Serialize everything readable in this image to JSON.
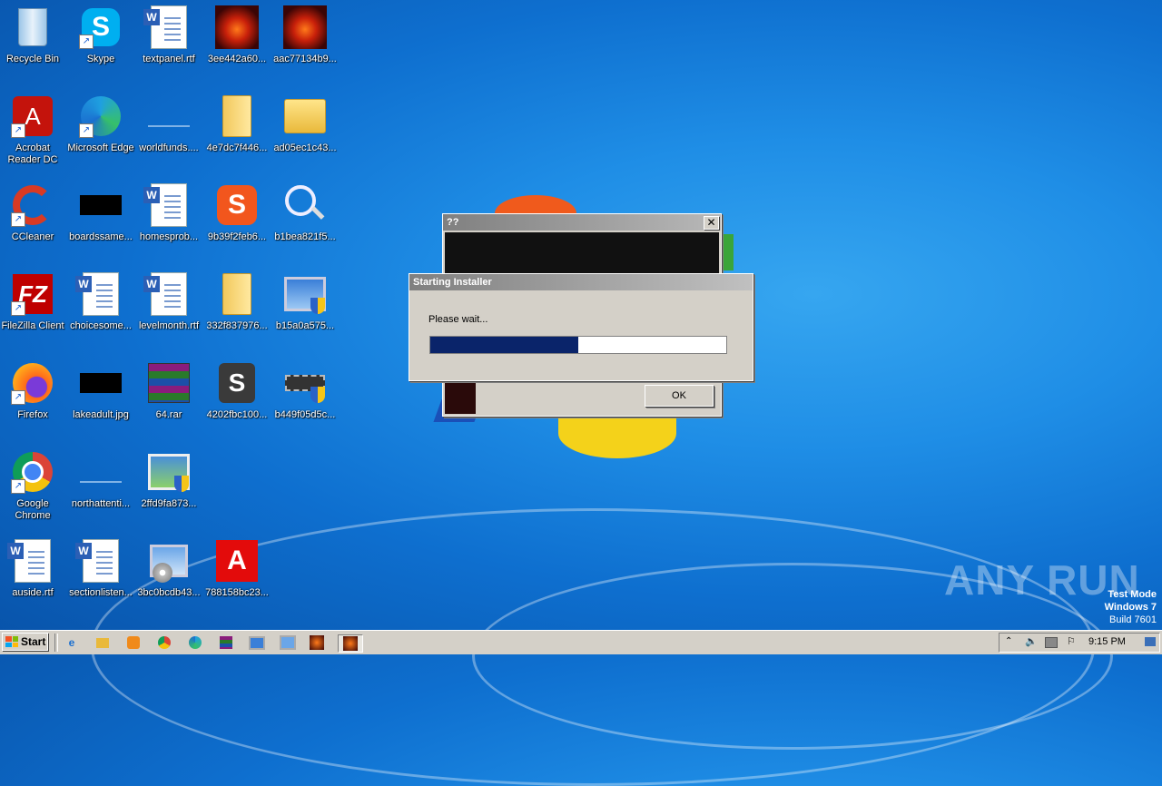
{
  "desktop_icons": [
    {
      "label": "Recycle Bin",
      "icon": "recycle-bin-icon"
    },
    {
      "label": "Skype",
      "icon": "skype-icon"
    },
    {
      "label": "textpanel.rtf",
      "icon": "word-document-icon"
    },
    {
      "label": "3ee442a60...",
      "icon": "fire-horse-icon"
    },
    {
      "label": "aac77134b9...",
      "icon": "fire-horse-icon"
    },
    {
      "label": "Acrobat Reader DC",
      "icon": "acrobat-icon"
    },
    {
      "label": "Microsoft Edge",
      "icon": "edge-icon"
    },
    {
      "label": "worldfunds....",
      "icon": "blank-file-icon"
    },
    {
      "label": "4e7dc7f446...",
      "icon": "folder-icon"
    },
    {
      "label": "ad05ec1c43...",
      "icon": "folder-icon"
    },
    {
      "label": "CCleaner",
      "icon": "ccleaner-icon"
    },
    {
      "label": "boardssame...",
      "icon": "black-image-icon"
    },
    {
      "label": "homesprob...",
      "icon": "word-document-icon"
    },
    {
      "label": "9b39f2feb6...",
      "icon": "sogou-icon"
    },
    {
      "label": "b1bea821f5...",
      "icon": "magnifier-icon"
    },
    {
      "label": "FileZilla Client",
      "icon": "filezilla-icon"
    },
    {
      "label": "choicesome...",
      "icon": "word-document-icon"
    },
    {
      "label": "levelmonth.rtf",
      "icon": "word-document-icon"
    },
    {
      "label": "332f837976...",
      "icon": "folder-icon"
    },
    {
      "label": "b15a0a575...",
      "icon": "monitor-shield-icon"
    },
    {
      "label": "Firefox",
      "icon": "firefox-icon"
    },
    {
      "label": "lakeadult.jpg",
      "icon": "black-image-icon"
    },
    {
      "label": "64.rar",
      "icon": "winrar-icon"
    },
    {
      "label": "4202fbc100...",
      "icon": "sandboxie-icon"
    },
    {
      "label": "b449f05d5c...",
      "icon": "chip-shield-icon"
    },
    {
      "label": "Google Chrome",
      "icon": "chrome-icon"
    },
    {
      "label": "northattenti...",
      "icon": "blank-file-icon"
    },
    {
      "label": "2ffd9fa873...",
      "icon": "image-shield-icon"
    },
    {
      "label": "auside.rtf",
      "icon": "word-document-icon"
    },
    {
      "label": "sectionlisten...",
      "icon": "word-document-icon"
    },
    {
      "label": "3bc0bcdb43...",
      "icon": "installer-icon"
    },
    {
      "label": "788158bc23...",
      "icon": "adobe-icon"
    }
  ],
  "back_dialog": {
    "title": "??",
    "ok_label": "OK"
  },
  "installer_dialog": {
    "title": "Starting Installer",
    "message": "Please wait...",
    "progress": 0.5
  },
  "taskbar": {
    "start_label": "Start",
    "clock": "9:15 PM"
  },
  "watermark": "ANY RUN",
  "test_mode": {
    "line1": "Test Mode",
    "line2": "Windows 7",
    "line3": "Build 7601"
  }
}
